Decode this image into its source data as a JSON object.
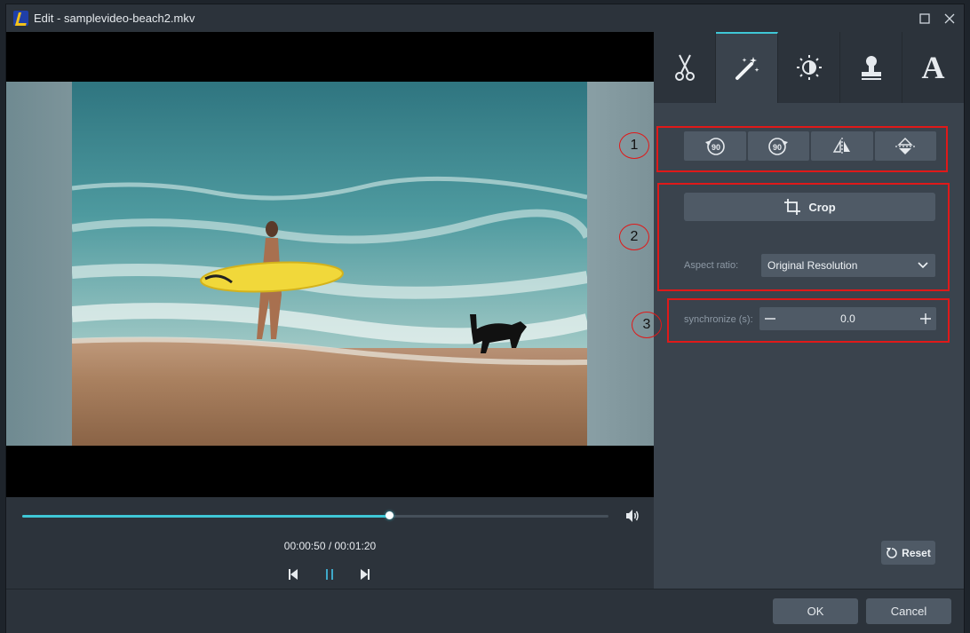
{
  "window": {
    "title": "Edit - samplevideo-beach2.mkv"
  },
  "player": {
    "current_time": "00:00:50",
    "duration": "00:01:20",
    "time_display": "00:00:50 / 00:01:20",
    "progress_fraction": 0.625
  },
  "tabs": [
    {
      "name": "trim",
      "icon": "scissors-icon"
    },
    {
      "name": "effects",
      "icon": "magic-wand-icon",
      "active": true
    },
    {
      "name": "adjust",
      "icon": "brightness-icon"
    },
    {
      "name": "watermark",
      "icon": "stamp-icon"
    },
    {
      "name": "text",
      "icon": "text-icon",
      "glyph": "A"
    }
  ],
  "annotations": [
    "1",
    "2",
    "3"
  ],
  "rotate": {
    "rotate_left_label": "90",
    "rotate_right_label": "90"
  },
  "crop": {
    "label": "Crop",
    "aspect_label": "Aspect ratio:",
    "aspect_value": "Original Resolution"
  },
  "sync": {
    "label": "synchronize (s):",
    "value": "0.0"
  },
  "reset_label": "Reset",
  "footer": {
    "ok_label": "OK",
    "cancel_label": "Cancel"
  },
  "colors": {
    "accent": "#3fc7d6",
    "highlight": "#e01919",
    "panel": "#3a434d",
    "button": "#4f5a66"
  }
}
